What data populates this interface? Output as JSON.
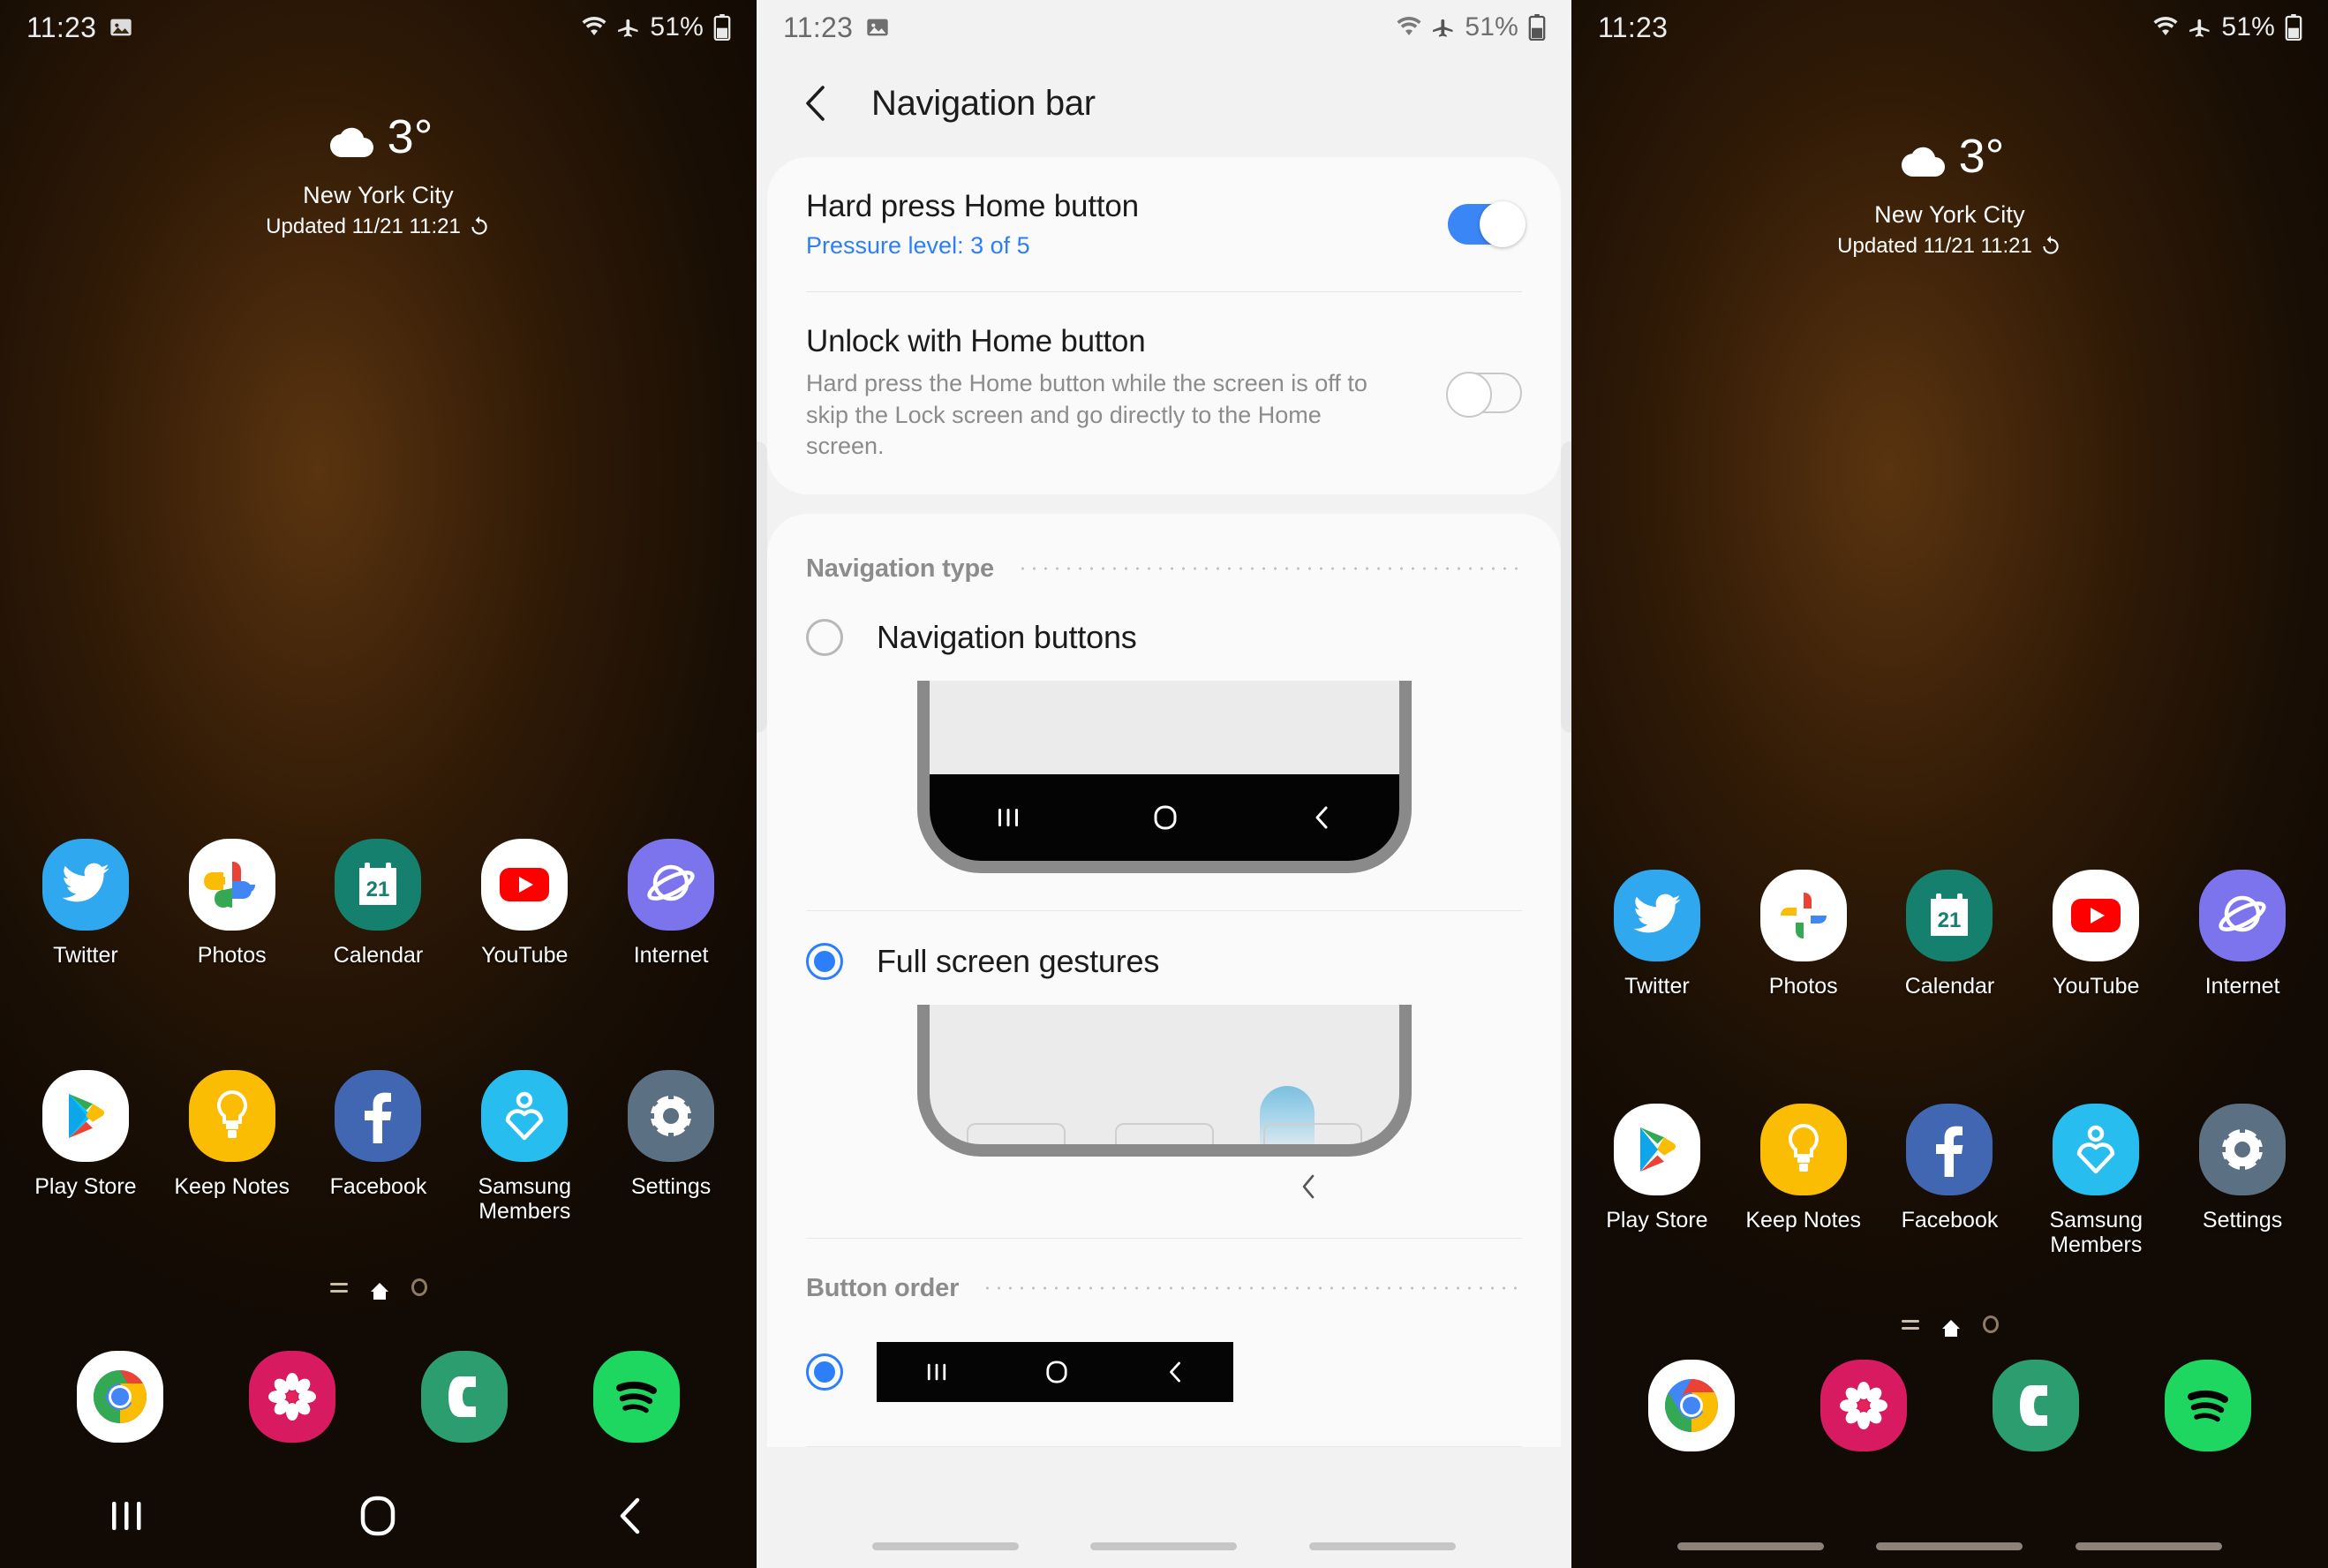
{
  "status_bar": {
    "time": "11:23",
    "battery_percent": "51%",
    "icons": [
      "image-icon",
      "wifi-icon",
      "airplane-mode-icon",
      "battery-icon"
    ]
  },
  "home_screen": {
    "weather": {
      "temperature": "3°",
      "condition_icon": "cloud-icon",
      "city": "New York City",
      "updated": "Updated 11/21 11:21",
      "refresh_icon": "refresh-icon"
    },
    "apps_row_1": [
      {
        "label": "Twitter",
        "icon": "twitter-icon"
      },
      {
        "label": "Photos",
        "icon": "google-photos-icon"
      },
      {
        "label": "Calendar",
        "icon": "calendar-icon",
        "day": "21"
      },
      {
        "label": "YouTube",
        "icon": "youtube-icon"
      },
      {
        "label": "Internet",
        "icon": "samsung-internet-icon"
      }
    ],
    "apps_row_2": [
      {
        "label": "Play Store",
        "icon": "play-store-icon"
      },
      {
        "label": "Keep Notes",
        "icon": "keep-notes-icon"
      },
      {
        "label": "Facebook",
        "icon": "facebook-icon"
      },
      {
        "label": "Samsung Members",
        "icon": "samsung-members-icon"
      },
      {
        "label": "Settings",
        "icon": "settings-gear-icon"
      }
    ],
    "dock": [
      {
        "label": "Chrome",
        "icon": "chrome-icon"
      },
      {
        "label": "Gallery",
        "icon": "gallery-flower-icon"
      },
      {
        "label": "Phone",
        "icon": "phone-icon"
      },
      {
        "label": "Spotify",
        "icon": "spotify-icon"
      }
    ],
    "page_indicator": [
      "apps-list-icon",
      "home-icon",
      "circle-icon"
    ],
    "nav_bar_buttons": [
      {
        "name": "recents",
        "icon": "recents-icon"
      },
      {
        "name": "home",
        "icon": "home-square-icon"
      },
      {
        "name": "back",
        "icon": "back-chevron-icon"
      }
    ]
  },
  "settings": {
    "back_icon": "back-chevron-icon",
    "title": "Navigation bar",
    "hard_press": {
      "title": "Hard press Home button",
      "subtitle": "Pressure level: 3 of 5",
      "toggle_state": "on"
    },
    "unlock_home": {
      "title": "Unlock with Home button",
      "description": "Hard press the Home button while the screen is off to skip the Lock screen and go directly to the Home screen.",
      "toggle_state": "off"
    },
    "navigation_type": {
      "section_label": "Navigation type",
      "options": [
        {
          "label": "Navigation buttons",
          "selected": false
        },
        {
          "label": "Full screen gestures",
          "selected": true
        }
      ]
    },
    "button_order": {
      "section_label": "Button order",
      "options": [
        {
          "order": [
            "recents-icon",
            "home-square-icon",
            "back-chevron-icon"
          ],
          "selected": true
        }
      ]
    }
  },
  "colors": {
    "accent_blue": "#2d7ff9",
    "toggle_on": "#3b86f7",
    "settings_bg": "#f2f2f2",
    "card_bg": "#fafafa",
    "nav_black": "#050505"
  }
}
